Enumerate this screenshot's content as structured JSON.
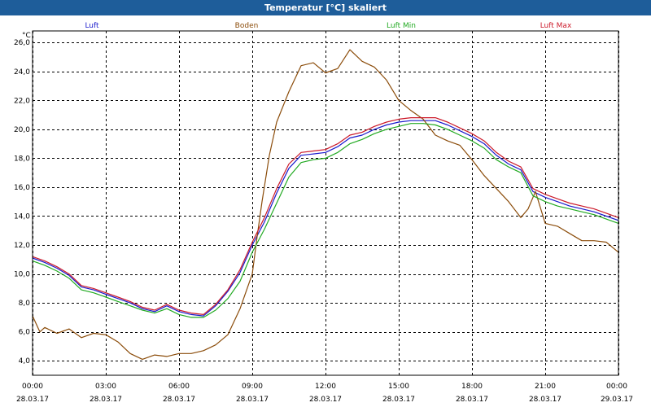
{
  "window": {
    "title": "Temperatur [°C] skaliert"
  },
  "chart_data": {
    "type": "line",
    "ylabel": "°C",
    "ylim": [
      3.0,
      26.8
    ],
    "yticks": [
      4.0,
      6.0,
      8.0,
      10.0,
      12.0,
      14.0,
      16.0,
      18.0,
      20.0,
      22.0,
      24.0,
      26.0
    ],
    "ytick_labels": [
      "4,0",
      "6,0",
      "8,0",
      "10,0",
      "12,0",
      "14,0",
      "16,0",
      "18,0",
      "20,0",
      "22,0",
      "24,0",
      "26,0"
    ],
    "xlim": [
      0,
      24
    ],
    "xticks": [
      0,
      3,
      6,
      9,
      12,
      15,
      18,
      21,
      24
    ],
    "xtick_time_labels": [
      "00:00",
      "03:00",
      "06:00",
      "09:00",
      "12:00",
      "15:00",
      "18:00",
      "21:00",
      "00:00"
    ],
    "xtick_date_labels": [
      "28.03.17",
      "28.03.17",
      "28.03.17",
      "28.03.17",
      "28.03.17",
      "28.03.17",
      "28.03.17",
      "28.03.17",
      "29.03.17"
    ],
    "grid": true,
    "legend_position": "top",
    "series": [
      {
        "name": "Luft",
        "color": "#1a1acc",
        "x": [
          0,
          0.5,
          1,
          1.5,
          2,
          2.5,
          3,
          3.5,
          4,
          4.5,
          5,
          5.5,
          6,
          6.5,
          7,
          7.5,
          8,
          8.5,
          9,
          9.5,
          10,
          10.5,
          11,
          11.5,
          12,
          12.5,
          13,
          13.5,
          14,
          14.5,
          15,
          15.5,
          16,
          16.5,
          17,
          17.5,
          18,
          18.5,
          19,
          19.5,
          20,
          20.5,
          21,
          21.5,
          22,
          22.5,
          23,
          23.5,
          24
        ],
        "y": [
          11.1,
          10.8,
          10.4,
          9.9,
          9.1,
          8.9,
          8.6,
          8.3,
          8.0,
          7.6,
          7.4,
          7.8,
          7.4,
          7.2,
          7.1,
          7.8,
          8.8,
          10.1,
          12.0,
          13.6,
          15.6,
          17.3,
          18.2,
          18.3,
          18.4,
          18.8,
          19.4,
          19.6,
          20.0,
          20.3,
          20.5,
          20.6,
          20.6,
          20.6,
          20.3,
          19.9,
          19.5,
          19.0,
          18.2,
          17.6,
          17.2,
          15.7,
          15.3,
          15.0,
          14.7,
          14.5,
          14.3,
          14.0,
          13.7
        ]
      },
      {
        "name": "Boden",
        "color": "#8b4c0a",
        "x": [
          0,
          0.3,
          0.5,
          1,
          1.5,
          2,
          2.5,
          3,
          3.5,
          4,
          4.5,
          5,
          5.5,
          6,
          6.5,
          7,
          7.5,
          8,
          8.5,
          9,
          9.2,
          9.4,
          9.7,
          10,
          10.5,
          11,
          11.5,
          12,
          12.5,
          13,
          13.5,
          14,
          14.5,
          15,
          15.5,
          16,
          16.5,
          17,
          17.5,
          18,
          18.5,
          19,
          19.5,
          20,
          20.3,
          20.6,
          21,
          21.5,
          22,
          22.5,
          23,
          23.5,
          24
        ],
        "y": [
          7.1,
          6.0,
          6.3,
          5.9,
          6.2,
          5.6,
          5.9,
          5.8,
          5.3,
          4.5,
          4.1,
          4.4,
          4.3,
          4.5,
          4.5,
          4.7,
          5.1,
          5.8,
          7.6,
          10.0,
          12.6,
          15.0,
          18.2,
          20.5,
          22.6,
          24.4,
          24.6,
          23.9,
          24.2,
          25.5,
          24.7,
          24.3,
          23.4,
          22.0,
          21.3,
          20.7,
          19.6,
          19.2,
          18.9,
          17.9,
          16.8,
          15.9,
          15.0,
          13.9,
          14.5,
          15.7,
          13.5,
          13.3,
          12.8,
          12.3,
          12.3,
          12.2,
          11.5
        ]
      },
      {
        "name": "Luft Min",
        "color": "#22aa22",
        "x": [
          0,
          0.5,
          1,
          1.5,
          2,
          2.5,
          3,
          3.5,
          4,
          4.5,
          5,
          5.5,
          6,
          6.5,
          7,
          7.5,
          8,
          8.5,
          9,
          9.5,
          10,
          10.5,
          11,
          11.5,
          12,
          12.5,
          13,
          13.5,
          14,
          14.5,
          15,
          15.5,
          16,
          16.5,
          17,
          17.5,
          18,
          18.5,
          19,
          19.5,
          20,
          20.5,
          21,
          21.5,
          22,
          22.5,
          23,
          23.5,
          24
        ],
        "y": [
          10.9,
          10.6,
          10.2,
          9.7,
          8.9,
          8.7,
          8.4,
          8.1,
          7.8,
          7.5,
          7.3,
          7.6,
          7.2,
          7.0,
          7.0,
          7.5,
          8.3,
          9.5,
          11.5,
          13.1,
          14.9,
          16.7,
          17.7,
          17.9,
          18.0,
          18.4,
          19.0,
          19.3,
          19.7,
          20.0,
          20.2,
          20.4,
          20.4,
          20.3,
          20.0,
          19.6,
          19.2,
          18.7,
          17.9,
          17.4,
          17.0,
          15.4,
          15.0,
          14.7,
          14.5,
          14.3,
          14.1,
          13.8,
          13.5
        ]
      },
      {
        "name": "Luft Max",
        "color": "#cc1a2a",
        "x": [
          0,
          0.5,
          1,
          1.5,
          2,
          2.5,
          3,
          3.5,
          4,
          4.5,
          5,
          5.5,
          6,
          6.5,
          7,
          7.5,
          8,
          8.5,
          9,
          9.5,
          10,
          10.5,
          11,
          11.5,
          12,
          12.5,
          13,
          13.5,
          14,
          14.5,
          15,
          15.5,
          16,
          16.5,
          17,
          17.5,
          18,
          18.5,
          19,
          19.5,
          20,
          20.5,
          21,
          21.5,
          22,
          22.5,
          23,
          23.5,
          24
        ],
        "y": [
          11.2,
          10.9,
          10.5,
          10.0,
          9.2,
          9.0,
          8.7,
          8.4,
          8.1,
          7.7,
          7.5,
          7.9,
          7.5,
          7.3,
          7.2,
          7.9,
          8.9,
          10.3,
          12.2,
          13.9,
          15.9,
          17.6,
          18.4,
          18.5,
          18.6,
          19.0,
          19.6,
          19.8,
          20.2,
          20.5,
          20.7,
          20.8,
          20.8,
          20.8,
          20.5,
          20.1,
          19.7,
          19.2,
          18.4,
          17.8,
          17.4,
          15.9,
          15.5,
          15.2,
          14.9,
          14.7,
          14.5,
          14.2,
          13.9
        ]
      }
    ]
  }
}
